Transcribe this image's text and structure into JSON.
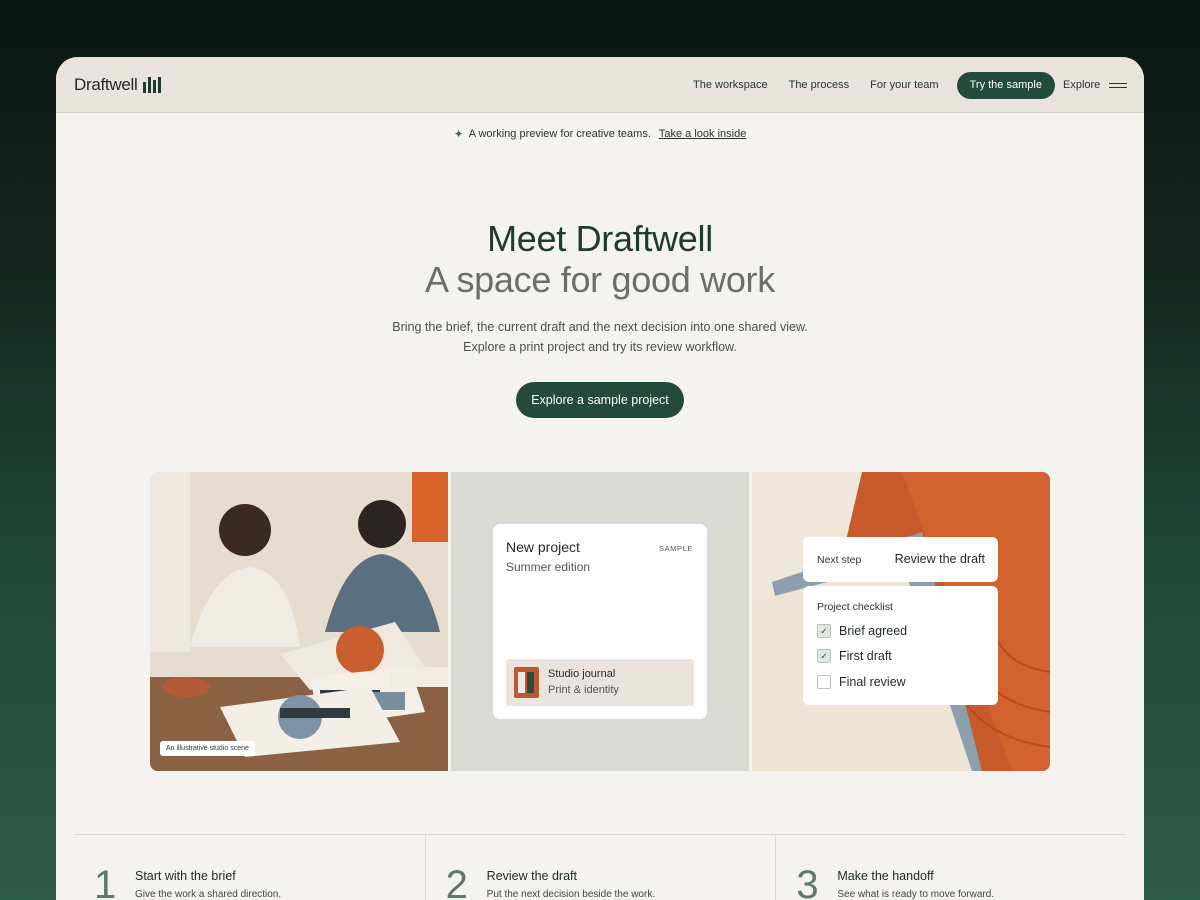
{
  "brand": {
    "name": "Draftwell"
  },
  "nav": {
    "links": [
      "The workspace",
      "The process",
      "For your team"
    ],
    "cta": "Try the sample",
    "explore": "Explore"
  },
  "announcement": {
    "text": "A working preview for creative teams.",
    "link": "Take a look inside"
  },
  "hero": {
    "title": "Meet Draftwell",
    "subtitle": "A space for good work",
    "desc_line1": "Bring the brief, the current draft and the next decision into one shared view.",
    "desc_line2": "Explore a print project and try its review workflow.",
    "button": "Explore a sample project"
  },
  "panel1": {
    "caption": "An illustrative studio scene"
  },
  "panel2": {
    "title": "New project",
    "subtitle": "Summer edition",
    "badge": "SAMPLE",
    "project_name": "Studio journal",
    "project_meta": "Print & identity"
  },
  "panel3": {
    "next_label": "Next step",
    "next_value": "Review the draft",
    "checklist_title": "Project checklist",
    "items": [
      {
        "label": "Brief agreed",
        "checked": true
      },
      {
        "label": "First draft",
        "checked": true
      },
      {
        "label": "Final review",
        "checked": false
      }
    ]
  },
  "steps": [
    {
      "num": "1",
      "title": "Start with the brief",
      "desc": "Give the work a shared direction."
    },
    {
      "num": "2",
      "title": "Review the draft",
      "desc": "Put the next decision beside the work."
    },
    {
      "num": "3",
      "title": "Make the handoff",
      "desc": "See what is ready to move forward."
    }
  ],
  "colors": {
    "accent": "#234a3a",
    "orange": "#c45a2c",
    "nav_bg": "#ebe4dc"
  }
}
